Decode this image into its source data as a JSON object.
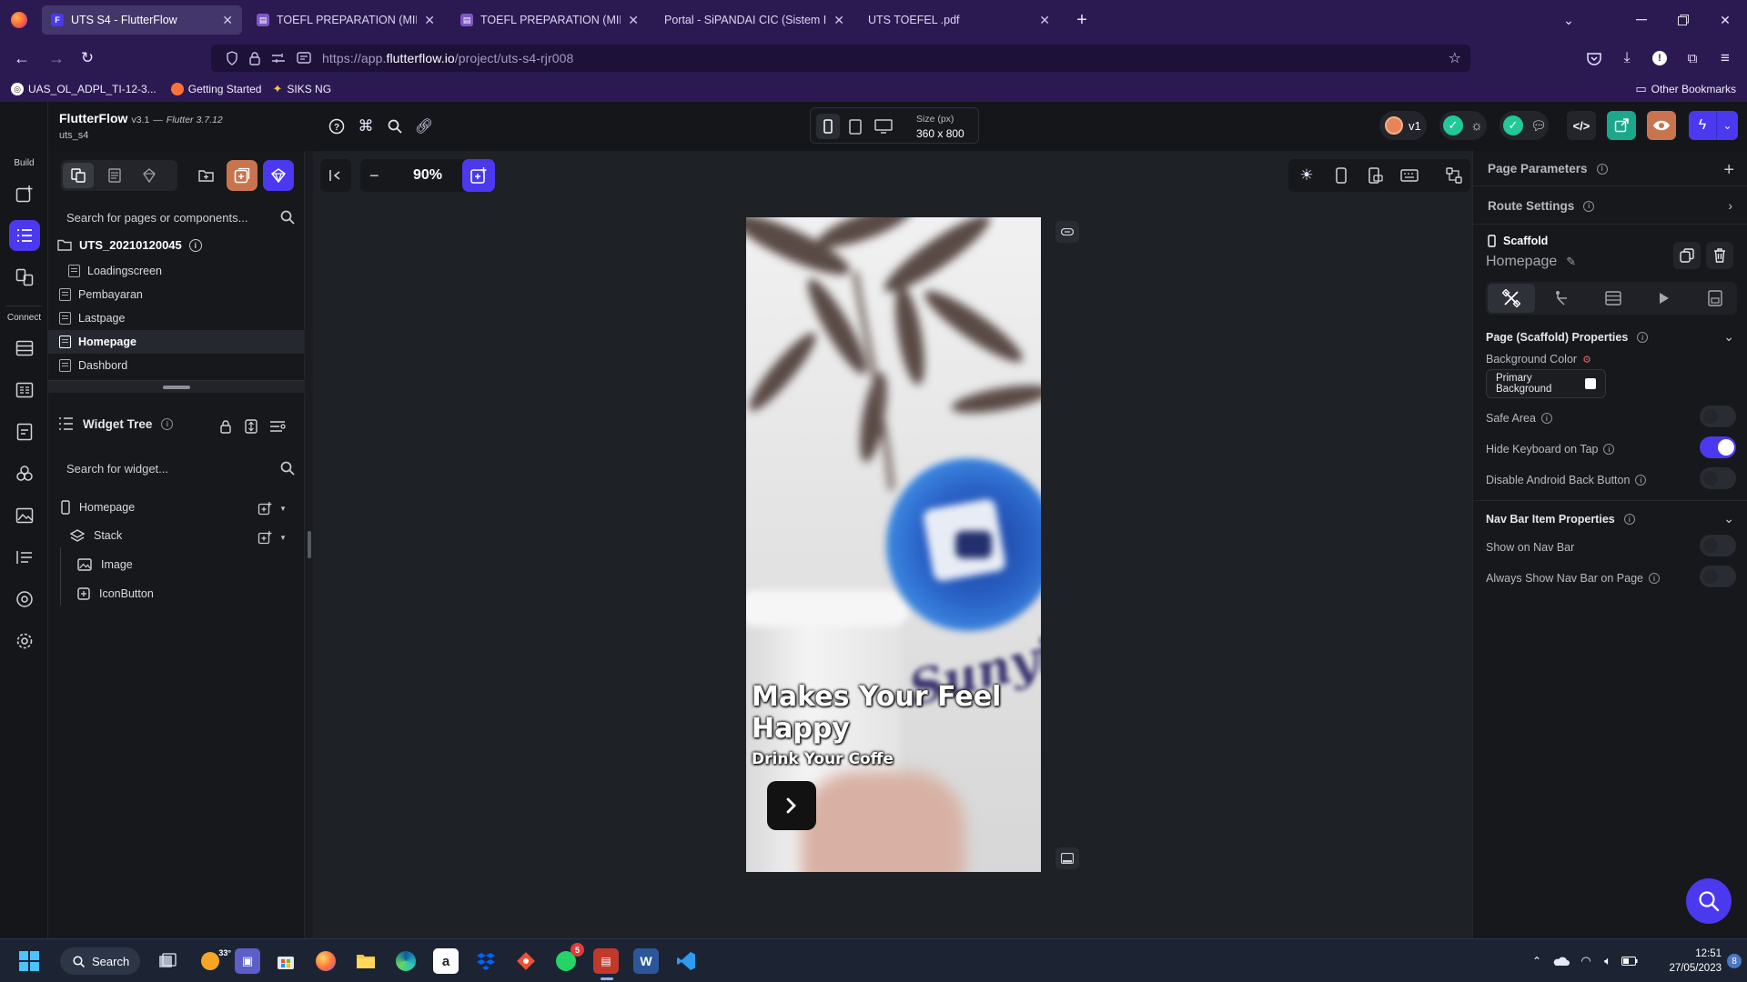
{
  "browser": {
    "tabs": [
      {
        "title": "UTS S4 - FlutterFlow",
        "active": true
      },
      {
        "title": "TOEFL PREPARATION (MID TERM",
        "active": false
      },
      {
        "title": "TOEFL PREPARATION (MID TERM",
        "active": false
      },
      {
        "title": "Portal - SiPANDAI CIC (Sistem Inform",
        "active": false
      },
      {
        "title": "UTS TOEFEL .pdf",
        "active": false
      }
    ],
    "url_prefix": "https://app.",
    "url_domain": "flutterflow.io",
    "url_path": "/project/uts-s4-rjr008",
    "bookmarks": [
      "UAS_OL_ADPL_TI-12-3...",
      "Getting Started",
      "SIKS NG"
    ],
    "other_bookmarks": "Other Bookmarks"
  },
  "app": {
    "name": "FlutterFlow",
    "version": "v3.1",
    "flutter_version": "Flutter 3.7.12",
    "project": "uts_s4",
    "device_size_label": "Size (px)",
    "device_size": "360 x 800",
    "version_badge": "v1",
    "accent": "#4b39ef"
  },
  "rail": {
    "build_label": "Build",
    "connect_label": "Connect"
  },
  "left_panel": {
    "search_placeholder": "Search for pages or components...",
    "project_folder": "UTS_20210120045",
    "pages": [
      "Loadingscreen",
      "Pembayaran",
      "Lastpage",
      "Homepage",
      "Dashbord"
    ],
    "selected_page": "Homepage",
    "widget_tree_title": "Widget Tree",
    "widget_search_placeholder": "Search for widget...",
    "tree": [
      "Homepage",
      "Stack",
      "Image",
      "IconButton"
    ]
  },
  "canvas": {
    "zoom": "90%",
    "headline": "Makes Your Feel Happy",
    "subline": "Drink Your Coffe",
    "cup_brand": "Sunyi"
  },
  "right_panel": {
    "page_parameters": "Page Parameters",
    "route_settings": "Route Settings",
    "widget_type": "Scaffold",
    "widget_name": "Homepage",
    "section_title": "Page (Scaffold) Properties",
    "background_color_label": "Background Color",
    "background_color_value": "Primary Background",
    "safe_area": "Safe Area",
    "hide_keyboard": "Hide Keyboard on Tap",
    "disable_back": "Disable Android Back Button",
    "nav_section": "Nav Bar Item Properties",
    "show_nav": "Show on Nav Bar",
    "always_show_nav": "Always Show Nav Bar on Page",
    "toggles": {
      "safe_area": false,
      "hide_keyboard": true,
      "disable_back": false,
      "show_nav": false,
      "always_show_nav": false
    }
  },
  "taskbar": {
    "search_label": "Search",
    "weather": "33°",
    "whatsapp_badge": "5",
    "time": "12:51",
    "date": "27/05/2023",
    "notification_count": "8"
  }
}
